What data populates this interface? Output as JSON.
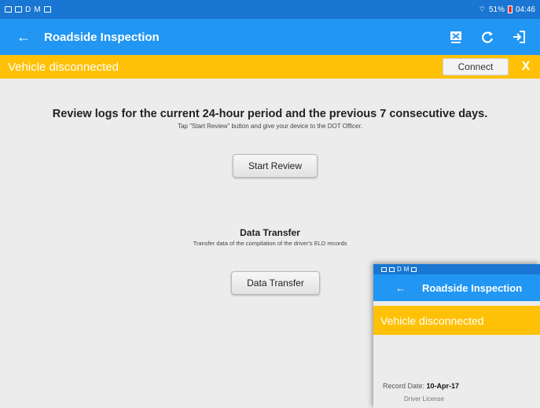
{
  "statusbar": {
    "left_letters": [
      "D",
      "M"
    ],
    "battery": "51%",
    "time": "04:46"
  },
  "appbar": {
    "back_icon": "arrow-left-icon",
    "title": "Roadside Inspection",
    "actions": [
      "transfer-icon",
      "refresh-icon",
      "logout-icon"
    ]
  },
  "banner": {
    "text": "Vehicle disconnected",
    "connect_label": "Connect",
    "close_label": "X",
    "color": "#ffc107"
  },
  "review": {
    "heading": "Review logs for the current 24-hour period and the previous 7 consecutive days.",
    "subtext": "Tap \"Start Review\" button and give your device to the DOT Officer.",
    "button_label": "Start Review"
  },
  "transfer": {
    "heading": "Data Transfer",
    "subtext": "Transfer data of the compilation of the driver's ELD records",
    "button_label": "Data Transfer"
  },
  "overlay": {
    "status_letters": [
      "D",
      "M"
    ],
    "title": "Roadside Inspection",
    "banner_text": "Vehicle disconnected",
    "record_date_label": "Record Date:",
    "record_date_value": "10-Apr-17",
    "license_label": "Driver License"
  },
  "colors": {
    "status_bar": "#1976d2",
    "app_bar": "#2196f3",
    "banner": "#ffc107"
  }
}
